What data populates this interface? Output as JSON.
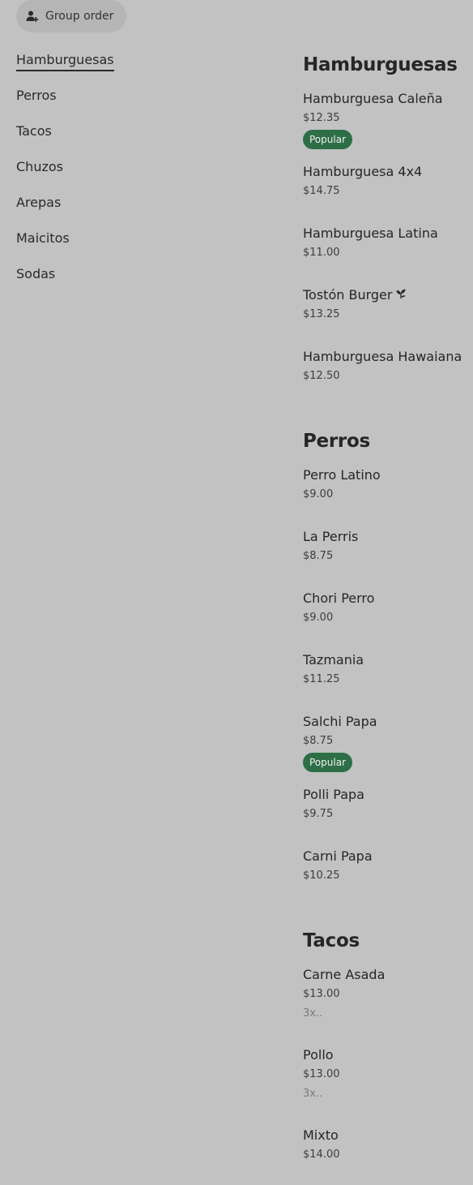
{
  "group_order": {
    "label": "Group order",
    "icon": "person-add-icon"
  },
  "sidebar": {
    "items": [
      {
        "label": "Hamburguesas",
        "active": true
      },
      {
        "label": "Perros"
      },
      {
        "label": "Tacos"
      },
      {
        "label": "Chuzos"
      },
      {
        "label": "Arepas"
      },
      {
        "label": "Maicitos"
      },
      {
        "label": "Sodas"
      }
    ]
  },
  "menu": {
    "sections": [
      {
        "title": "Hamburguesas",
        "items": [
          {
            "name": "Hamburguesa Caleña",
            "price": "$12.35",
            "badge": "Popular"
          },
          {
            "name": "Hamburguesa 4x4",
            "price": "$14.75"
          },
          {
            "name": "Hamburguesa Latina",
            "price": "$11.00"
          },
          {
            "name": "Tostón Burger",
            "price": "$13.25",
            "icon": "leaf-icon"
          },
          {
            "name": "Hamburguesa Hawaiana",
            "price": "$12.50"
          }
        ]
      },
      {
        "title": "Perros",
        "items": [
          {
            "name": "Perro Latino",
            "price": "$9.00"
          },
          {
            "name": "La Perris",
            "price": "$8.75"
          },
          {
            "name": "Chori Perro",
            "price": "$9.00"
          },
          {
            "name": "Tazmania",
            "price": "$11.25"
          },
          {
            "name": "Salchi Papa",
            "price": "$8.75",
            "badge": "Popular"
          },
          {
            "name": "Polli Papa",
            "price": "$9.75"
          },
          {
            "name": "Carni Papa",
            "price": "$10.25"
          }
        ]
      },
      {
        "title": "Tacos",
        "items": [
          {
            "name": "Carne Asada",
            "price": "$13.00",
            "desc": "3x.."
          },
          {
            "name": "Pollo",
            "price": "$13.00",
            "desc": "3x.."
          },
          {
            "name": "Mixto",
            "price": "$14.00"
          }
        ]
      }
    ]
  },
  "colors": {
    "background": "#c2c2c2",
    "badge": "#2e6e47",
    "button": "#b5b5b5"
  }
}
